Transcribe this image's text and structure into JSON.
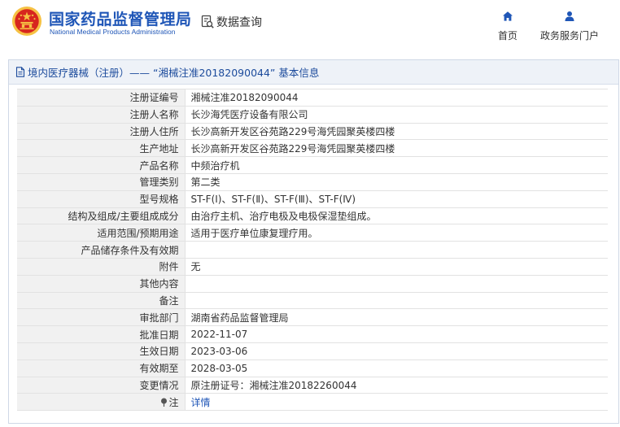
{
  "header": {
    "org_name_cn": "国家药品监督管理局",
    "org_name_en": "National Medical Products Administration",
    "query_label": "数据查询",
    "nav": {
      "home_label": "首页",
      "service_label": "政务服务门户"
    }
  },
  "panel": {
    "title": "境内医疗器械（注册）—— “湘械注准20182090044” 基本信息"
  },
  "rows": [
    {
      "label": "注册证编号",
      "value": "湘械注准20182090044"
    },
    {
      "label": "注册人名称",
      "value": "长沙海凭医疗设备有限公司"
    },
    {
      "label": "注册人住所",
      "value": "长沙高新开发区谷苑路229号海凭园聚英楼四楼"
    },
    {
      "label": "生产地址",
      "value": "长沙高新开发区谷苑路229号海凭园聚英楼四楼"
    },
    {
      "label": "产品名称",
      "value": "中频治疗机"
    },
    {
      "label": "管理类别",
      "value": "第二类"
    },
    {
      "label": "型号规格",
      "value": "ST-F(Ⅰ)、ST-F(Ⅱ)、ST-F(Ⅲ)、ST-F(Ⅳ)"
    },
    {
      "label": "结构及组成/主要组成成分",
      "value": "由治疗主机、治疗电极及电极保湿垫组成。"
    },
    {
      "label": "适用范围/预期用途",
      "value": "适用于医疗单位康复理疗用。"
    },
    {
      "label": "产品储存条件及有效期",
      "value": ""
    },
    {
      "label": "附件",
      "value": "无"
    },
    {
      "label": "其他内容",
      "value": ""
    },
    {
      "label": "备注",
      "value": ""
    },
    {
      "label": "审批部门",
      "value": "湖南省药品监督管理局"
    },
    {
      "label": "批准日期",
      "value": "2022-11-07"
    },
    {
      "label": "生效日期",
      "value": "2023-03-06"
    },
    {
      "label": "有效期至",
      "value": "2028-03-05"
    },
    {
      "label": "变更情况",
      "value": "原注册证号：湘械注准20182260044"
    }
  ],
  "note_row": {
    "label": "注",
    "link_text": "详情"
  },
  "icons": {
    "emblem": "national-emblem-icon",
    "query": "document-search-icon",
    "home": "home-icon",
    "service": "user-icon",
    "panel": "document-icon",
    "note": "pin-icon"
  },
  "colors": {
    "brand_blue": "#1f56b7",
    "emblem_red": "#d7261e",
    "emblem_gold": "#f6c244",
    "panel_header_bg": "#eef2f8",
    "label_bg": "#f1f1f1"
  }
}
